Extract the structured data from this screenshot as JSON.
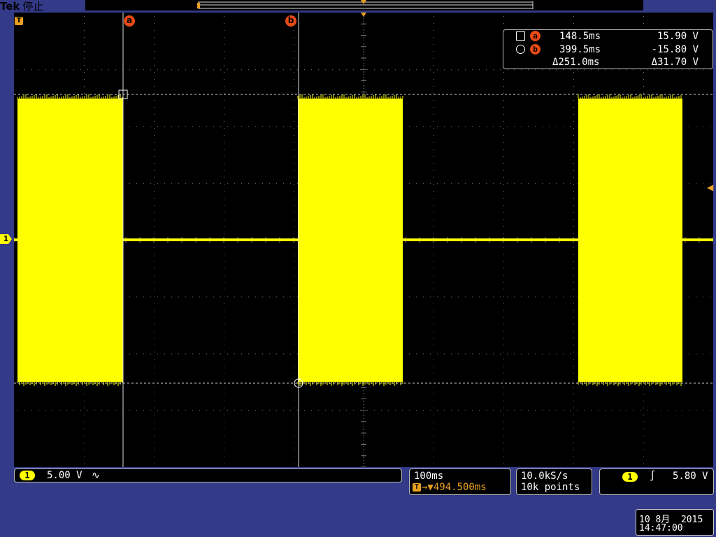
{
  "header": {
    "brand": "Tek",
    "status": "停止"
  },
  "cursor_labels": {
    "a": "a",
    "b": "b"
  },
  "trigger_marker": "T",
  "channel_marker": "1",
  "measurements": {
    "a": {
      "time": "148.5ms",
      "voltage": "15.90 V"
    },
    "b": {
      "time": "399.5ms",
      "voltage": "-15.80 V"
    },
    "delta": {
      "time": "Δ251.0ms",
      "voltage": "Δ31.70 V"
    }
  },
  "channel1": {
    "badge": "1",
    "scale": "5.00 V",
    "bandwidth_symbol": "∿"
  },
  "timebase": {
    "scale": "100ms",
    "trigger_badge": "T",
    "position": "→▼494.500ms"
  },
  "acquisition": {
    "sample_rate": "10.0kS/s",
    "record_length": "10k points"
  },
  "trigger": {
    "source": "1",
    "slope_symbol": "∫",
    "level": "5.80 V"
  },
  "datetime": {
    "date": "10 8月  2015",
    "time": "14:47:00"
  },
  "colors": {
    "trace": "#ffff00",
    "background": "#333a88",
    "cursor": "#e84a16",
    "grid": "#777777"
  }
}
